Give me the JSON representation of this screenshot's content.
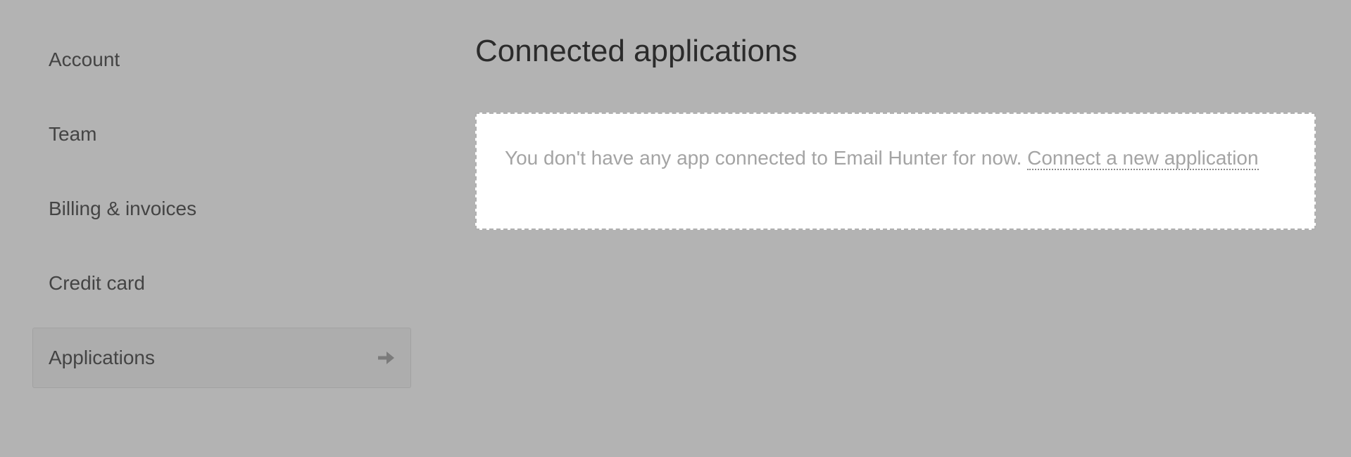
{
  "sidebar": {
    "items": [
      {
        "label": "Account",
        "active": false
      },
      {
        "label": "Team",
        "active": false
      },
      {
        "label": "Billing & invoices",
        "active": false
      },
      {
        "label": "Credit card",
        "active": false
      },
      {
        "label": "Applications",
        "active": true,
        "icon": "arrow-right-icon"
      }
    ]
  },
  "main": {
    "title": "Connected applications",
    "empty_state": {
      "message": "You don't have any app connected to Email Hunter for now.",
      "link_label": "Connect a new application"
    }
  },
  "colors": {
    "background": "#b3b3b3",
    "card": "#ffffff",
    "nav_text": "#444444",
    "muted_text": "#a4a4a4"
  }
}
